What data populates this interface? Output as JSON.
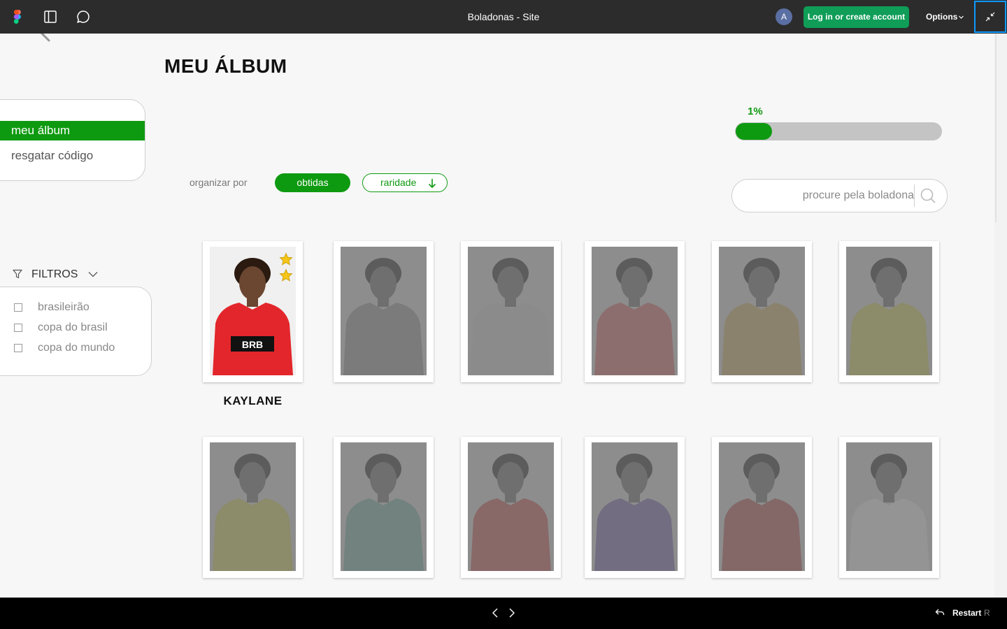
{
  "topbar": {
    "title": "Boladonas - Site",
    "avatar_initial": "A",
    "login_label": "Log in or create account",
    "options_label": "Options"
  },
  "page": {
    "title": "MEU ÁLBUM"
  },
  "menu": {
    "items": [
      {
        "label": "meu álbum",
        "active": true
      },
      {
        "label": "resgatar código",
        "active": false
      }
    ]
  },
  "progress": {
    "label": "1%",
    "fraction": 0.01
  },
  "sort": {
    "label": "organizar por",
    "obtidas_label": "obtidas",
    "raridade_label": "raridade"
  },
  "search": {
    "placeholder": "procure pela boladona"
  },
  "filters": {
    "title": "FILTROS",
    "options": [
      "brasileirão",
      "copa do brasil",
      "copa do mundo"
    ]
  },
  "album": {
    "cards": [
      {
        "name": "KAYLANE",
        "owned": true,
        "stars": 2,
        "jersey_color": "#e3262b"
      },
      {
        "owned": false,
        "jersey_color": "#6d6d6d"
      },
      {
        "owned": false,
        "jersey_color": "#8a8a8a"
      },
      {
        "owned": false,
        "jersey_color": "#8e5656"
      },
      {
        "owned": false,
        "jersey_color": "#8a7a55"
      },
      {
        "owned": false,
        "jersey_color": "#8d8a4e"
      },
      {
        "owned": false,
        "jersey_color": "#8d8a4e"
      },
      {
        "owned": false,
        "jersey_color": "#5d7a73"
      },
      {
        "owned": false,
        "jersey_color": "#874b4b"
      },
      {
        "owned": false,
        "jersey_color": "#5f5378"
      },
      {
        "owned": false,
        "jersey_color": "#7d4a4a"
      },
      {
        "owned": false,
        "jersey_color": "#9a9a9a"
      }
    ]
  },
  "bottombar": {
    "restart_label": "Restart",
    "restart_key": "R"
  },
  "colors": {
    "accent_green": "#0e9a10",
    "topbar_bg": "#2c2c2c",
    "login_green": "#0f9d58"
  }
}
